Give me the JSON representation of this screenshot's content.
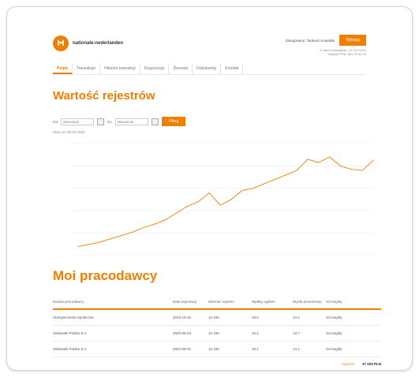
{
  "brand": {
    "name": "nationale-nederlanden",
    "logo_letters": "N"
  },
  "header": {
    "user": "Zalogowany: Tadeusz Kowalski",
    "logout_label": "Wyloguj",
    "contact_line1": "Z nami rozmawiasz: 22 522 0022",
    "contact_line2": "Infolinia PPK: 801 20 30 40"
  },
  "nav": {
    "items": [
      "Pulpit",
      "Transakcje",
      "Historia transakcji",
      "Dyspozycje",
      "Zlecenia",
      "Dokumenty",
      "Kontakt"
    ]
  },
  "main": {
    "title": "Wartość rejestrów",
    "filters": {
      "from_label": "Od",
      "from_value": "2019-05-01",
      "to_label": "Do",
      "to_value": "2020-09-30",
      "apply_label": "Filtruj"
    },
    "as_of": "Stan na: 05.01.2023"
  },
  "chart_data": {
    "type": "line",
    "xlabel": "",
    "ylabel": "",
    "x_ticks": [
      "",
      "",
      "",
      "",
      "",
      "",
      "",
      "",
      ""
    ],
    "y_ticks": [
      "",
      "",
      "",
      "",
      "",
      ""
    ],
    "ylim": [
      0,
      100
    ],
    "series": [
      {
        "values": [
          8,
          10,
          12,
          15,
          18,
          21,
          25,
          28,
          32,
          38,
          44,
          48,
          56,
          45,
          50,
          58,
          60,
          64,
          68,
          72,
          76,
          86,
          83,
          88,
          80,
          77,
          76,
          85
        ]
      }
    ],
    "color": "#ee7f00"
  },
  "employers": {
    "title": "Moi pracodawcy",
    "columns": [
      "Nazwa pracodawcy",
      "Data rejestracji",
      "Wartość rejestru",
      "Wpłaty ogółem",
      "Wynik procentowy",
      "Szczegóły"
    ],
    "rows": [
      [
        "Ubezpieczenia Społeczne",
        "2019-10-16",
        "12 340",
        "18.0",
        "14.4",
        "Szczegóły"
      ],
      [
        "Sadowski Polska S.A.",
        "2020-06-04",
        "12 340",
        "16.2",
        "13.7",
        "Szczegóły"
      ],
      [
        "Sadowski Polska S.A.",
        "2022-08-01",
        "12 340",
        "16.1",
        "14.1",
        "Szczegóły"
      ]
    ],
    "total_label": "Łącznie",
    "total_value": "37 020 PLN"
  }
}
